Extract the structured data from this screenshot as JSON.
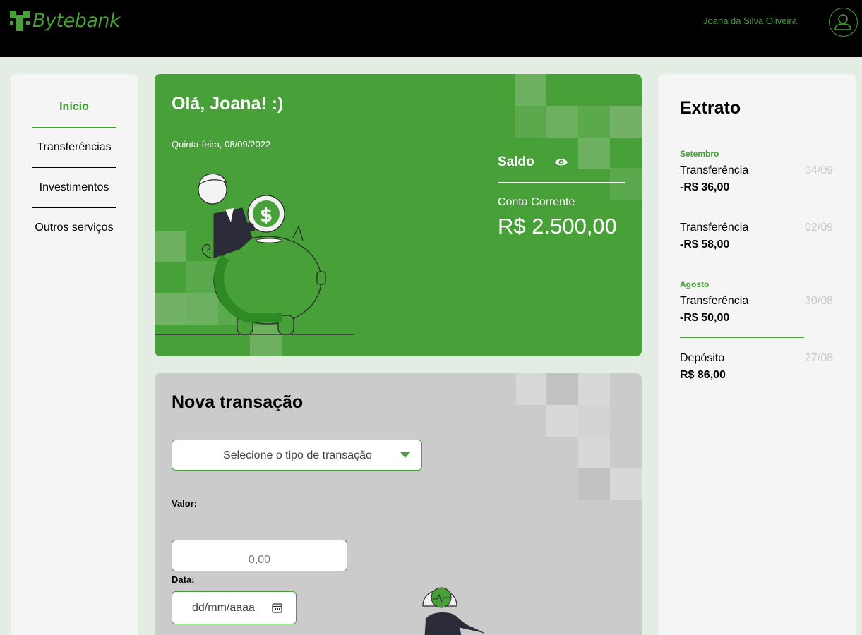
{
  "header": {
    "brand": "Bytebank",
    "user_name": "Joana da Silva Oliveira",
    "avatar_icon": "user-icon",
    "accent": "#47a138"
  },
  "sidebar": {
    "items": [
      {
        "label": "Início",
        "active": true
      },
      {
        "label": "Transferências",
        "active": false
      },
      {
        "label": "Investimentos",
        "active": false
      },
      {
        "label": "Outros serviços",
        "active": false
      }
    ]
  },
  "welcome": {
    "greeting": "Olá, Joana! :)",
    "date": "Quinta-feira, 08/09/2022",
    "balance_title": "Saldo",
    "balance_icon": "eye-icon",
    "account_label": "Conta Corrente",
    "account_value": "R$ 2.500,00",
    "bg_color": "#47a138"
  },
  "transaction": {
    "title": "Nova transação",
    "type_placeholder": "Selecione o tipo de transação",
    "value_label": "Valor:",
    "value_placeholder": "0,00",
    "date_label": "Data:",
    "date_placeholder": "dd/mm/aaaa",
    "bg_color": "#cbcbcb"
  },
  "statement": {
    "title": "Extrato",
    "groups": [
      {
        "month": "Setembro",
        "entries": [
          {
            "type": "Transferência",
            "date": "04/09",
            "value": "-R$ 36,00"
          },
          {
            "type": "Transferência",
            "date": "02/09",
            "value": "-R$ 58,00"
          }
        ]
      },
      {
        "month": "Agosto",
        "entries": [
          {
            "type": "Transferência",
            "date": "30/08",
            "value": "-R$ 50,00"
          },
          {
            "type": "Depósito",
            "date": "27/08",
            "value": "R$ 86,00"
          }
        ]
      }
    ]
  }
}
